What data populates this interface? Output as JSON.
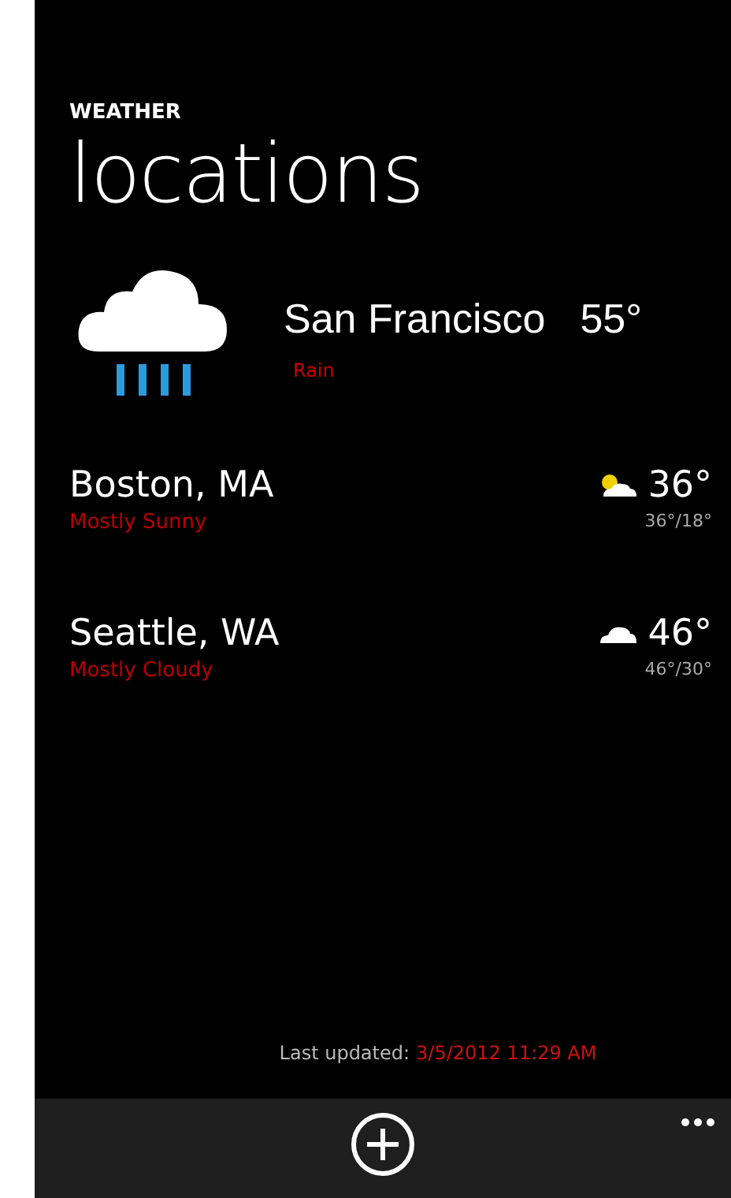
{
  "app": {
    "name": "WEATHER",
    "title": "locations"
  },
  "featured": {
    "city": "San Francisco",
    "temp": "55°",
    "condition": "Rain",
    "kind": "rain"
  },
  "locations": [
    {
      "city": "Boston, MA",
      "condition": "Mostly Sunny",
      "temp": "36°",
      "range": "36°/18°",
      "kind": "partly-sunny"
    },
    {
      "city": "Seattle, WA",
      "condition": "Mostly Cloudy",
      "temp": "46°",
      "range": "46°/30°",
      "kind": "cloudy"
    }
  ],
  "footer": {
    "label": "Last updated:",
    "value": "3/5/2012 11:29 AM"
  },
  "app_bar": {
    "buttons": [
      {
        "kind": "add"
      }
    ],
    "more": {
      "kind": "ellipsis"
    }
  }
}
